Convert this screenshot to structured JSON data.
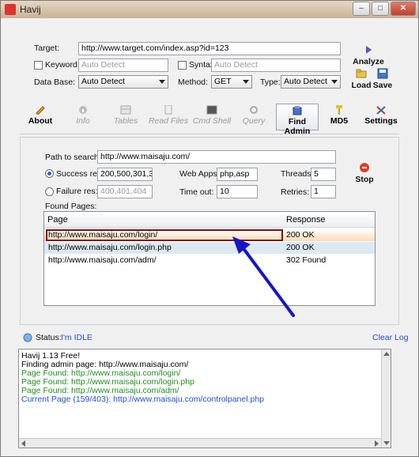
{
  "window": {
    "title": "Havij"
  },
  "target": {
    "label": "Target:",
    "url": "http://www.target.com/index.asp?id=123",
    "keyword_label": "Keyword:",
    "keyword_placeholder": "Auto Detect",
    "syntax_label": "Syntax:",
    "syntax_placeholder": "Auto Detect",
    "database_label": "Data Base:",
    "database_value": "Auto Detect",
    "method_label": "Method:",
    "method_value": "GET",
    "type_label": "Type:",
    "type_value": "Auto Detect"
  },
  "actions": {
    "analyze": "Analyze",
    "load": "Load",
    "save": "Save"
  },
  "tabs": [
    {
      "label": "About",
      "icon": "pencil-icon",
      "state": "enabled"
    },
    {
      "label": "Info",
      "icon": "info-icon",
      "state": "disabled"
    },
    {
      "label": "Tables",
      "icon": "table-icon",
      "state": "disabled"
    },
    {
      "label": "Read Files",
      "icon": "file-icon",
      "state": "disabled"
    },
    {
      "label": "Cmd Shell",
      "icon": "terminal-icon",
      "state": "disabled"
    },
    {
      "label": "Query",
      "icon": "query-icon",
      "state": "disabled"
    },
    {
      "label": "Find Admin",
      "icon": "admin-icon",
      "state": "active"
    },
    {
      "label": "MD5",
      "icon": "key-icon",
      "state": "enabled"
    },
    {
      "label": "Settings",
      "icon": "tools-icon",
      "state": "enabled"
    }
  ],
  "find_admin": {
    "path_label": "Path to search:",
    "path_value": "http://www.maisaju.com/",
    "success_label": "Success res:",
    "success_value": "200,500,301,3",
    "failure_label": "Failure res:",
    "failure_value": "400,401,404",
    "webapps_label": "Web Apps:",
    "webapps_value": "php,asp",
    "timeout_label": "Time out:",
    "timeout_value": "10",
    "threads_label": "Threads:",
    "threads_value": "5",
    "retries_label": "Retries:",
    "retries_value": "1",
    "stop_label": "Stop",
    "found_label": "Found Pages:",
    "columns": {
      "page": "Page",
      "response": "Response"
    },
    "rows": [
      {
        "page": "http://www.maisaju.com/login/",
        "response": "200 OK"
      },
      {
        "page": "http://www.maisaju.com/login.php",
        "response": "200 OK"
      },
      {
        "page": "http://www.maisaju.com/adm/",
        "response": "302 Found"
      }
    ]
  },
  "status": {
    "label": "Status:",
    "value": "I'm IDLE",
    "clear_log": "Clear Log"
  },
  "log": [
    {
      "text": "Havij 1.13 Free!",
      "color": "#000000"
    },
    {
      "text": "Finding admin page: http://www.maisaju.com/",
      "color": "#000000"
    },
    {
      "text": "Page Found: http://www.maisaju.com/login/",
      "color": "#1e8f1e"
    },
    {
      "text": "Page Found: http://www.maisaju.com/login.php",
      "color": "#1e8f1e"
    },
    {
      "text": "Page Found: http://www.maisaju.com/adm/",
      "color": "#1e8f1e"
    },
    {
      "text": "Current Page (159/403): http://www.maisaju.com/controlpanel.php",
      "color": "#1f4fd1"
    }
  ],
  "annotation": {
    "color": "#1515c8"
  }
}
